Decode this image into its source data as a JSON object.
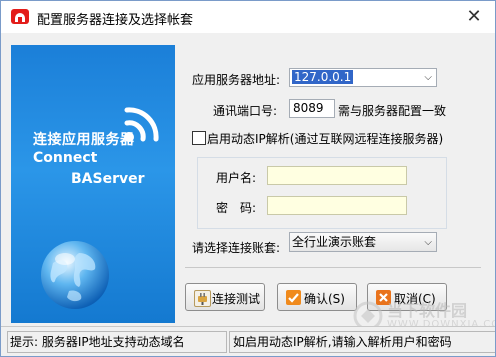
{
  "window": {
    "title": "配置服务器连接及选择帐套",
    "close_glyph": "✕"
  },
  "banner": {
    "line_cn": "连接应用服务器",
    "line_en1": "Connect",
    "line_en2": "BAServer"
  },
  "form": {
    "server_label": "应用服务器地址:",
    "server_value": "127.0.0.1",
    "port_label": "通讯端口号:",
    "port_value": "8089",
    "port_note": "需与服务器配置一致",
    "dynamic_ip_label": "启用动态IP解析(通过互联网远程连接服务器)",
    "dynamic_ip_checked": false,
    "username_label": "用户名:",
    "username_value": "",
    "password_label": "密　码:",
    "password_value": "",
    "account_label": "请选择连接账套:",
    "account_value": "全行业演示账套"
  },
  "buttons": {
    "test_label": "连接测试",
    "confirm_label": "确认(S)",
    "cancel_label": "取消(C)"
  },
  "statusbar": {
    "hint_left": "提示: 服务器IP地址支持动态域名",
    "hint_right": "如启用动态IP解析,请输入解析用户和密码"
  },
  "watermark": {
    "brand": "当下软件园",
    "sub": "WWW.DOWNXIA.COM"
  },
  "colors": {
    "banner": "#2b96e8",
    "selection": "#3166c8",
    "input_yellow": "#ffffe1",
    "icon_red": "#e31d1a"
  }
}
